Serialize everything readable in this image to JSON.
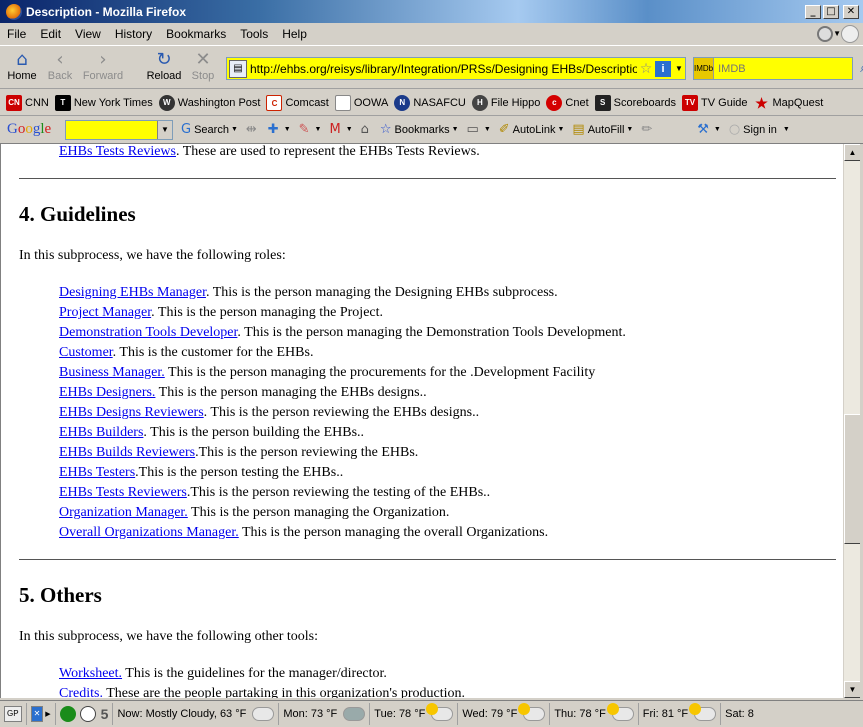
{
  "window": {
    "title": "Description - Mozilla Firefox",
    "controls": [
      "_",
      "□",
      "✕"
    ]
  },
  "menu": [
    "File",
    "Edit",
    "View",
    "History",
    "Bookmarks",
    "Tools",
    "Help"
  ],
  "nav": {
    "home": "Home",
    "back": "Back",
    "forward": "Forward",
    "reload": "Reload",
    "stop": "Stop",
    "url": "http://ehbs.org/reisys/library/Integration/PRSs/Designing EHBs/Description.h",
    "search_engine": "IMDb",
    "search_placeholder": "IMDB"
  },
  "bookmarks": [
    {
      "label": "CNN",
      "icon": "cnn-icon",
      "color": "#cc0000"
    },
    {
      "label": "New York Times",
      "icon": "nyt-icon",
      "color": "#000000"
    },
    {
      "label": "Washington Post",
      "icon": "wapo-icon",
      "color": "#333333"
    },
    {
      "label": "Comcast",
      "icon": "comcast-icon",
      "color": "#cc2200"
    },
    {
      "label": "OOWA",
      "icon": "page-icon",
      "color": "#ffffff"
    },
    {
      "label": "NASAFCU",
      "icon": "nasafcu-icon",
      "color": "#1a3a8a"
    },
    {
      "label": "File Hippo",
      "icon": "filehippo-icon",
      "color": "#444444"
    },
    {
      "label": "Cnet",
      "icon": "cnet-icon",
      "color": "#d40000"
    },
    {
      "label": "Scoreboards",
      "icon": "scoreboards-icon",
      "color": "#222222"
    },
    {
      "label": "TV Guide",
      "icon": "tvguide-icon",
      "color": "#cc0000"
    },
    {
      "label": "MapQuest",
      "icon": "mapquest-icon",
      "color": "#cc0000"
    }
  ],
  "google_toolbar": {
    "logo": "Google",
    "search_label": "Search",
    "bookmarks_label": "Bookmarks",
    "autolink_label": "AutoLink",
    "autofill_label": "AutoFill",
    "signin_label": "Sign in"
  },
  "page": {
    "top_line": {
      "link": "EHBs Tests Reviews",
      "text": ". These are used to represent the EHBs Tests Reviews."
    },
    "section4": {
      "heading": "4. Guidelines",
      "intro": "In this subprocess, we have the following roles:",
      "items": [
        {
          "link": "Designing EHBs Manager",
          "text": ". This is the person managing the Designing EHBs subprocess."
        },
        {
          "link": "Project Manager",
          "text": ". This is the person managing the Project."
        },
        {
          "link": "Demonstration Tools Developer",
          "text": ". This is the person managing the Demonstration Tools Development."
        },
        {
          "link": "Customer",
          "text": ". This is the customer for the EHBs."
        },
        {
          "link": "Business Manager.",
          "text": " This is the person managing the procurements for the .Development Facility"
        },
        {
          "link": "EHBs Designers.",
          "text": " This is the person managing the EHBs designs.."
        },
        {
          "link": "EHBs Designs Reviewers",
          "text": ". This is the person reviewing the EHBs designs.."
        },
        {
          "link": "EHBs Builders",
          "text": ". This is the person building the EHBs.."
        },
        {
          "link": "EHBs Builds Reviewers",
          "text": ".This is the person reviewing the EHBs."
        },
        {
          "link": "EHBs Testers",
          "text": ".This is the person testing the EHBs.."
        },
        {
          "link": "EHBs Tests Reviewers",
          "text": ".This is the person reviewing the testing of the EHBs.."
        },
        {
          "link": "Organization Manager.",
          "text": " This is the person managing the Organization."
        },
        {
          "link": "Overall Organizations Manager.",
          "text": " This is the person managing the overall Organizations."
        }
      ]
    },
    "section5": {
      "heading": "5. Others",
      "intro": "In this subprocess, we have the following other tools:",
      "items": [
        {
          "link": "Worksheet.",
          "text": " This is the guidelines for the manager/director."
        },
        {
          "link": "Credits.",
          "text": " These are the people partaking in this organization's production."
        }
      ]
    }
  },
  "status": {
    "gp": "GP",
    "count": "5",
    "now": "Now: Mostly Cloudy, 63 °F",
    "mon": "Mon: 73 °F",
    "tue": "Tue: 78 °F",
    "wed": "Wed: 79 °F",
    "thu": "Thu: 78 °F",
    "fri": "Fri: 81 °F",
    "sat": "Sat: 8"
  }
}
